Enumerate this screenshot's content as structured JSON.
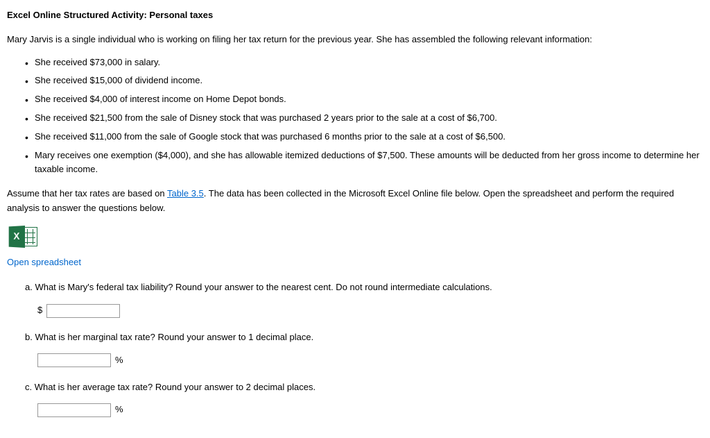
{
  "title": "Excel Online Structured Activity: Personal taxes",
  "intro": "Mary Jarvis is a single individual who is working on filing her tax return for the previous year. She has assembled the following relevant information:",
  "bullets": [
    "She received $73,000 in salary.",
    "She received $15,000 of dividend income.",
    "She received $4,000 of interest income on Home Depot bonds.",
    "She received $21,500 from the sale of Disney stock that was purchased 2 years prior to the sale at a cost of $6,700.",
    "She received $11,000 from the sale of Google stock that was purchased 6 months prior to the sale at a cost of $6,500.",
    "Mary receives one exemption ($4,000), and she has allowable itemized deductions of $7,500. These amounts will be deducted from her gross income to determine her taxable income."
  ],
  "assume": {
    "part1": "Assume that her tax rates are based on ",
    "link": "Table 3.5",
    "part2": ". The data has been collected in the Microsoft Excel Online file below. Open the spreadsheet and perform the required analysis to answer the questions below."
  },
  "excel_x": "X",
  "open_link": "Open spreadsheet",
  "questions": {
    "a": {
      "label": "a. What is Mary's federal tax liability? Round your answer to the nearest cent. Do not round intermediate calculations.",
      "prefix": "$",
      "suffix": ""
    },
    "b": {
      "label": "b. What is her marginal tax rate? Round your answer to 1 decimal place.",
      "prefix": "",
      "suffix": "%"
    },
    "c": {
      "label": "c. What is her average tax rate? Round your answer to 2 decimal places.",
      "prefix": "",
      "suffix": "%"
    }
  }
}
